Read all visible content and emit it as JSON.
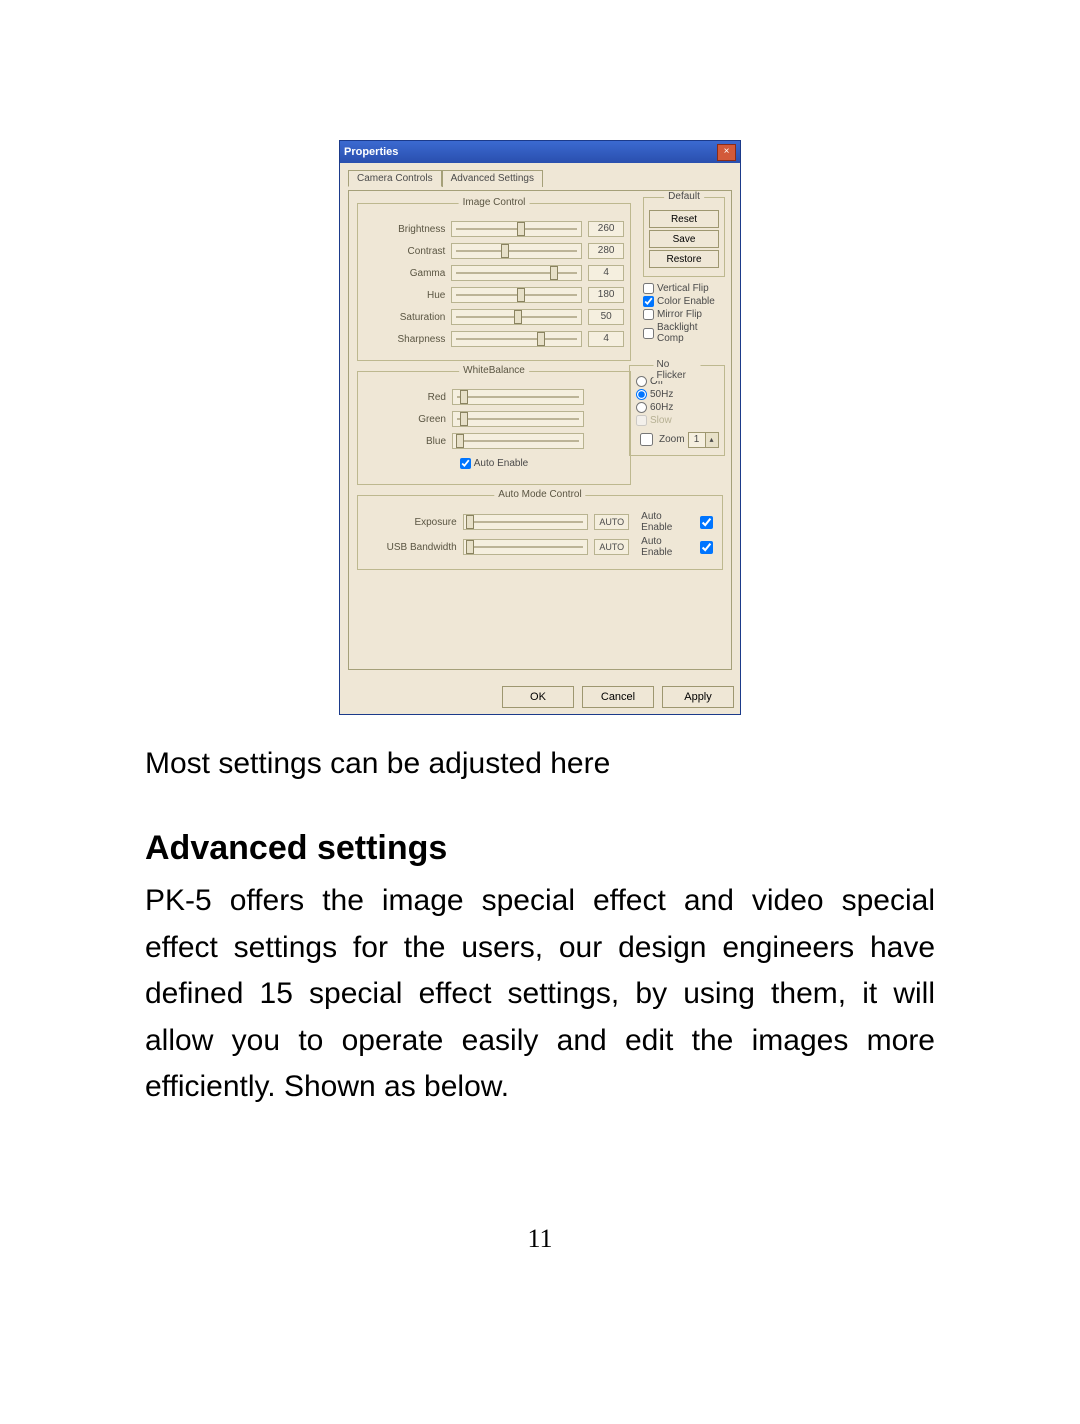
{
  "dialog": {
    "title": "Properties",
    "tabs": [
      "Camera Controls",
      "Advanced Settings"
    ],
    "active_tab": 0,
    "image_control": {
      "legend": "Image Control",
      "sliders": [
        {
          "label": "Brightness",
          "value": "260",
          "pos": 50
        },
        {
          "label": "Contrast",
          "value": "280",
          "pos": 38
        },
        {
          "label": "Gamma",
          "value": "4",
          "pos": 76
        },
        {
          "label": "Hue",
          "value": "180",
          "pos": 50
        },
        {
          "label": "Saturation",
          "value": "50",
          "pos": 48
        },
        {
          "label": "Sharpness",
          "value": "4",
          "pos": 66
        }
      ]
    },
    "default_group": {
      "legend": "Default",
      "buttons": [
        "Reset",
        "Save",
        "Restore"
      ]
    },
    "side_checks": [
      {
        "label": "Vertical Flip",
        "checked": false
      },
      {
        "label": "Color Enable",
        "checked": true
      },
      {
        "label": "Mirror Flip",
        "checked": false
      },
      {
        "label": "Backlight Comp",
        "checked": false
      }
    ],
    "white_balance": {
      "legend": "WhiteBalance",
      "sliders": [
        {
          "label": "Red",
          "pos": 5
        },
        {
          "label": "Green",
          "pos": 5
        },
        {
          "label": "Blue",
          "pos": 2
        }
      ],
      "auto_enable": {
        "label": "Auto Enable",
        "checked": true
      }
    },
    "flicker": {
      "legend": "No Flicker",
      "options": [
        {
          "label": "Off",
          "checked": false
        },
        {
          "label": "50Hz",
          "checked": true
        },
        {
          "label": "60Hz",
          "checked": false
        }
      ],
      "slow_label": "Slow",
      "zoom": {
        "label": "Zoom",
        "value": "1"
      }
    },
    "auto_mode": {
      "legend": "Auto Mode Control",
      "rows": [
        {
          "label": "Exposure",
          "badge": "AUTO",
          "auto_label": "Auto Enable",
          "checked": true
        },
        {
          "label": "USB Bandwidth",
          "badge": "AUTO",
          "auto_label": "Auto Enable",
          "checked": true
        }
      ]
    },
    "buttons": {
      "ok": "OK",
      "cancel": "Cancel",
      "apply": "Apply"
    }
  },
  "doc": {
    "caption": "Most settings can be adjusted here",
    "heading": "Advanced settings",
    "body": "PK-5 offers the image special effect and video special effect settings for the users, our design engineers have defined 15 special effect settings, by using them, it will allow you to operate easily and edit the images more efficiently. Shown as below.",
    "page_number": "11"
  }
}
